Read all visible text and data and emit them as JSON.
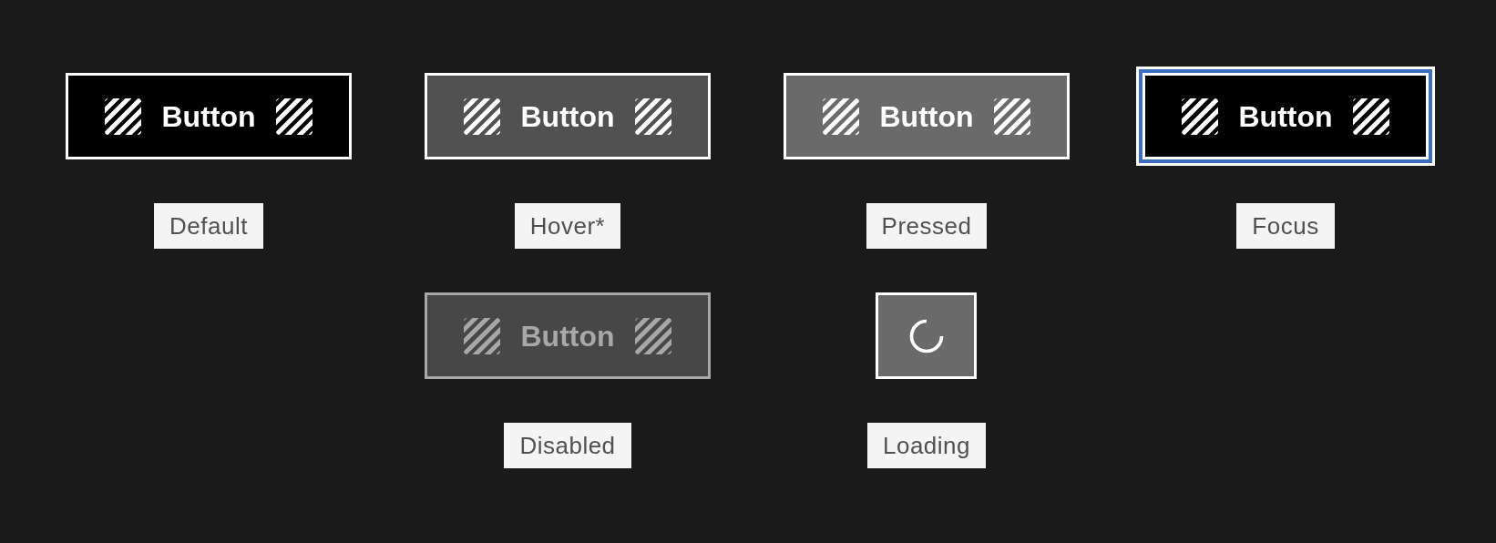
{
  "columns": [
    {
      "items": [
        {
          "kind": "default",
          "text": "Button",
          "label": "Default"
        }
      ]
    },
    {
      "items": [
        {
          "kind": "hover",
          "text": "Button",
          "label": "Hover*"
        },
        {
          "kind": "disabled",
          "text": "Button",
          "label": "Disabled"
        }
      ]
    },
    {
      "items": [
        {
          "kind": "pressed",
          "text": "Button",
          "label": "Pressed"
        },
        {
          "kind": "loading",
          "label": "Loading"
        }
      ]
    },
    {
      "items": [
        {
          "kind": "focus",
          "text": "Button",
          "label": "Focus"
        }
      ]
    }
  ]
}
